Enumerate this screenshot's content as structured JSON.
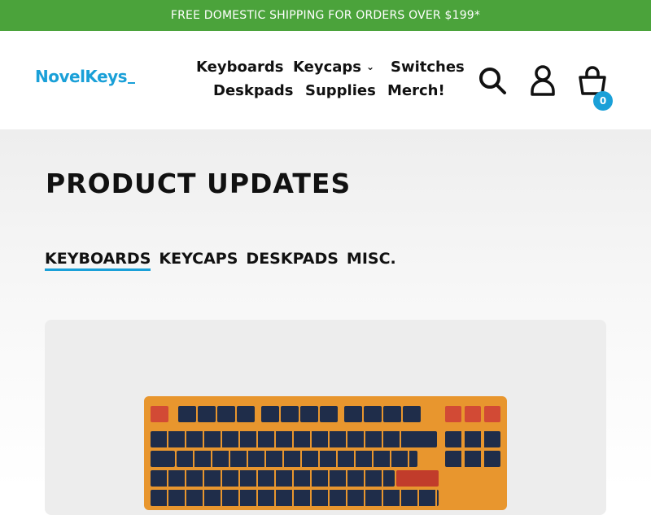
{
  "banner": {
    "text": "FREE DOMESTIC SHIPPING FOR ORDERS OVER $199*"
  },
  "header": {
    "logo": "NovelKeys",
    "nav": [
      {
        "label": "Keyboards"
      },
      {
        "label": "Keycaps"
      },
      {
        "label": "Switches"
      },
      {
        "label": "Deskpads"
      },
      {
        "label": "Supplies"
      },
      {
        "label": "Merch!"
      }
    ],
    "icons": {
      "search": "search-icon",
      "account": "user-icon",
      "cart": "cart-icon"
    },
    "cart_count": "0"
  },
  "page": {
    "title": "PRODUCT UPDATES",
    "tabs": [
      {
        "label": "KEYBOARDS",
        "active": true
      },
      {
        "label": "KEYCAPS"
      },
      {
        "label": "DESKPADS"
      },
      {
        "label": "MISC."
      }
    ]
  },
  "colors": {
    "banner": "#4ba33b",
    "accent": "#1aa0d8",
    "keyboard_case": "#e8962e",
    "keycap_navy": "#1f2d4a",
    "keycap_red": "#d24a35"
  }
}
